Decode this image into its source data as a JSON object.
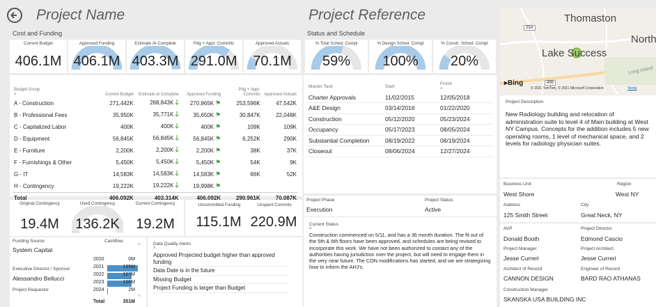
{
  "header": {
    "title": "Project Name",
    "subtitle": "Cost and Funding",
    "ref_title": "Project Reference",
    "ref_subtitle": "Status and Schedule"
  },
  "cost_kpis": [
    {
      "label": "Current Budget",
      "value": "406.1M",
      "fill": null
    },
    {
      "label": "Approved Funding",
      "value": "406.1M",
      "fill": 1.0
    },
    {
      "label": "Estimate At Complete",
      "value": "403.3M",
      "fill": 0.99
    },
    {
      "label": "Pdg + Appr. Commits",
      "value": "291.0M",
      "fill": 0.72
    },
    {
      "label": "Approved Actuals",
      "value": "70.1M",
      "fill": 0.17
    }
  ],
  "schedule_kpis": [
    {
      "label": "% Total Sched. Compl",
      "value": "59%",
      "fill": 0.59
    },
    {
      "label": "% Design Sched. Compl",
      "value": "100%",
      "fill": 1.0
    },
    {
      "label": "% Constr. Sched. Compl",
      "value": "20%",
      "fill": 0.2
    }
  ],
  "budget_table": {
    "headers": [
      "Budget Group",
      "Current Budget",
      "Estimate at Complete",
      "Approved Funding",
      "Pdg + Appr. Commits",
      "Approved Actuals"
    ],
    "rows": [
      {
        "group": "A - Construction",
        "budget": "271,442K",
        "eac": "268,843K",
        "eac_icon": "down-arrow",
        "funding": "270,965K",
        "fund_icon": "flag",
        "commits": "253,596K",
        "actuals": "47,542K"
      },
      {
        "group": "B - Professional Fees",
        "budget": "35,950K",
        "eac": "35,771K",
        "eac_icon": "down-arrow",
        "funding": "35,650K",
        "fund_icon": "flag",
        "commits": "30,847K",
        "actuals": "22,048K"
      },
      {
        "group": "C - Capitalized Labor",
        "budget": "400K",
        "eac": "400K",
        "eac_icon": "down-arrow",
        "funding": "400K",
        "fund_icon": "flag",
        "commits": "109K",
        "actuals": "109K"
      },
      {
        "group": "D - Equipment",
        "budget": "56,845K",
        "eac": "56,845K",
        "eac_icon": "down-arrow",
        "funding": "56,845K",
        "fund_icon": "flag",
        "commits": "6,252K",
        "actuals": "290K"
      },
      {
        "group": "E - Furniture",
        "budget": "2,200K",
        "eac": "2,200K",
        "eac_icon": "down-arrow",
        "funding": "2,200K",
        "fund_icon": "flag",
        "commits": "38K",
        "actuals": "37K"
      },
      {
        "group": "F - Furnishings & Other",
        "budget": "5,450K",
        "eac": "5,450K",
        "eac_icon": "down-arrow",
        "funding": "5,450K",
        "fund_icon": "flag",
        "commits": "54K",
        "actuals": "9K"
      },
      {
        "group": "G - IT",
        "budget": "14,583K",
        "eac": "14,583K",
        "eac_icon": "down-arrow",
        "funding": "14,583K",
        "fund_icon": "flag",
        "commits": "66K",
        "actuals": "52K"
      },
      {
        "group": "H - Contingency",
        "budget": "19,222K",
        "eac": "19,222K",
        "eac_icon": "down-arrow",
        "funding": "19,998K",
        "fund_icon": "flag",
        "commits": "",
        "actuals": ""
      }
    ],
    "total": {
      "group": "Total",
      "budget": "406,092K",
      "eac": "403,314K",
      "funding": "406,092K",
      "commits": "290,961K",
      "actuals": "70,087K"
    }
  },
  "master_tasks": {
    "headers": [
      "Master Task",
      "Start",
      "Finish"
    ],
    "rows": [
      {
        "task": "Charter Approvals",
        "start": "11/02/2015",
        "finish": "12/05/2018"
      },
      {
        "task": "A&E Design",
        "start": "03/14/2016",
        "finish": "01/22/2020"
      },
      {
        "task": "Construction",
        "start": "05/12/2020",
        "finish": "05/23/2024"
      },
      {
        "task": "Occupancy",
        "start": "05/17/2023",
        "finish": "08/05/2024"
      },
      {
        "task": "Substantial Completion",
        "start": "08/19/2022",
        "finish": "08/19/2024"
      },
      {
        "task": "Closeout",
        "start": "08/06/2024",
        "finish": "12/27/2024"
      }
    ]
  },
  "contingency": [
    {
      "label": "Original Contingency",
      "value": "19.4M",
      "fill": null
    },
    {
      "label": "Used Contingency",
      "value": "136.2K",
      "fill": 0.01
    },
    {
      "label": "Current Contingency",
      "value": "19.2M",
      "fill": null
    }
  ],
  "commitments": [
    {
      "label": "Uncommitted Funding",
      "value": "115.1M"
    },
    {
      "label": "Unspent Commits",
      "value": "220.9M"
    }
  ],
  "funding": {
    "source_label": "Funding Source",
    "source_value": "System Capital",
    "exec_label": "Executive Director / Sponsor",
    "exec_value": "Alessandro Bellucci",
    "requestor_label": "Project Requestor",
    "cashflow_label": "Cashflow",
    "cashflow": [
      {
        "year": "2020",
        "value": "0M",
        "amount": 0
      },
      {
        "year": "2021",
        "value": "135M",
        "amount": 135
      },
      {
        "year": "2022",
        "value": "107M",
        "amount": 107
      },
      {
        "year": "2023",
        "value": "106M",
        "amount": 106
      },
      {
        "year": "2024",
        "value": "2M",
        "amount": 2
      }
    ],
    "total_label": "Total",
    "total_value": "351M"
  },
  "alerts": {
    "title": "Data Quality Alerts",
    "items": [
      "Approved Projected budget higher than approved funding",
      "Data Date is in the future",
      "Missing Budget",
      "Project Funding is larger than Budget"
    ]
  },
  "phase": {
    "phase_label": "Project Phase",
    "phase_value": "Execution",
    "status_label": "Project Status",
    "status_value": "Active",
    "current_label": "Current Status",
    "current_text": "Construction commenced on 5/11, and has a 36 month duration. The fit out of the 5th & 6th floors have been approved, and schedules are being revised to incorporate this work. We have not been authorized to contact any of the authorities having jurisdiction over the project, but will need to engage them in the very near future. The CON modifications has started, and we are strategizing how to inform the AHJ's."
  },
  "map": {
    "label1": "Thomaston",
    "label2": "Lake Success",
    "label3": "North",
    "label4": "Long Island",
    "road1": "25A",
    "road2": "495",
    "brand": "Bing",
    "copyright": "© 2021 TomTom, © 2021 Microsoft Corporation",
    "terms": "Terms"
  },
  "description": {
    "label": "Project Description",
    "text": "New Radiology building and relocation of administration suite to level 4 of Main building at West NY Campus. Concepts for the addition includes 5 new operating rooms, 1 level of mechanical space, and 2 levels for radiology physician suites."
  },
  "location": {
    "bu_label": "Business Unit",
    "bu_value": "West Shore",
    "region_label": "Region",
    "region_value": "West NY",
    "address_label": "Address",
    "address_value": "125 Smith Street",
    "city_label": "City",
    "city_value": "Great Neck, NY"
  },
  "team": {
    "avp_label": "AVP",
    "avp_value": "Donald Booth",
    "director_label": "Project Director",
    "director_value": "Edmond Cascio",
    "manager_label": "Project Manager",
    "manager_value": "Jesse Curreri",
    "architect_label": "Project Architect",
    "architect_value": "Jesse Curreri",
    "aor_label": "Architect of Record",
    "aor_value": "CANNON DESIGN",
    "eor_label": "Engineer of Record",
    "eor_value": "BARD RAO ATHANAS",
    "cm_label": "Construction Manager",
    "cm_value": "SKANSKA USA BUILDING INC"
  },
  "colors": {
    "gauge_fill": "#a7cbe8",
    "gauge_track": "#e6e6e6",
    "cashflow_bar": "#4a90c8",
    "good": "#5aa33b"
  }
}
